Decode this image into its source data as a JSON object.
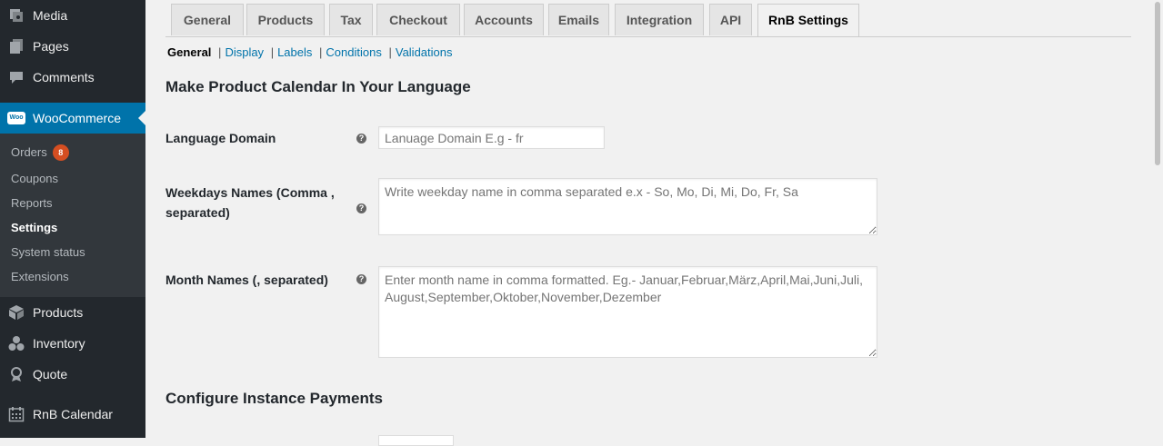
{
  "sidebar": {
    "items": [
      {
        "label": "Media",
        "icon": "media-icon"
      },
      {
        "label": "Pages",
        "icon": "pages-icon"
      },
      {
        "label": "Comments",
        "icon": "comments-icon"
      },
      {
        "label": "WooCommerce",
        "icon": "woocommerce-icon"
      },
      {
        "label": "Products",
        "icon": "products-icon"
      },
      {
        "label": "Inventory",
        "icon": "inventory-icon"
      },
      {
        "label": "Quote",
        "icon": "quote-icon"
      },
      {
        "label": "RnB Calendar",
        "icon": "calendar-icon"
      }
    ],
    "submenu": [
      {
        "label": "Orders",
        "badge": "8"
      },
      {
        "label": "Coupons"
      },
      {
        "label": "Reports"
      },
      {
        "label": "Settings"
      },
      {
        "label": "System status"
      },
      {
        "label": "Extensions"
      }
    ],
    "woo_icon_text": "Woo"
  },
  "tabs": [
    "General",
    "Products",
    "Tax",
    "Checkout",
    "Accounts",
    "Emails",
    "Integration",
    "API",
    "RnB Settings"
  ],
  "active_tab": "RnB Settings",
  "subnav": {
    "current": "General",
    "links": [
      "Display",
      "Labels",
      "Conditions",
      "Validations"
    ],
    "separator": "|"
  },
  "sections": {
    "language_title": "Make Product Calendar In Your Language",
    "payments_title": "Configure Instance Payments"
  },
  "fields": {
    "language_domain": {
      "label": "Language Domain",
      "placeholder": "Lanuage Domain E.g - fr"
    },
    "weekdays": {
      "label": "Weekdays Names (Comma , separated)",
      "placeholder": "Write weekday name in comma separated e.x - So, Mo, Di, Mi, Do, Fr, Sa"
    },
    "months": {
      "label": "Month Names (, separated)",
      "placeholder": "Enter month name in comma formatted. Eg.- Januar,Februar,März,April,Mai,Juni,Juli,August,September,Oktober,November,Dezember"
    },
    "help_glyph": "?"
  },
  "colors": {
    "sidebar_bg": "#23282d",
    "submenu_bg": "#32373c",
    "active_menu": "#0073aa",
    "link": "#0073aa",
    "badge": "#d54e21"
  }
}
